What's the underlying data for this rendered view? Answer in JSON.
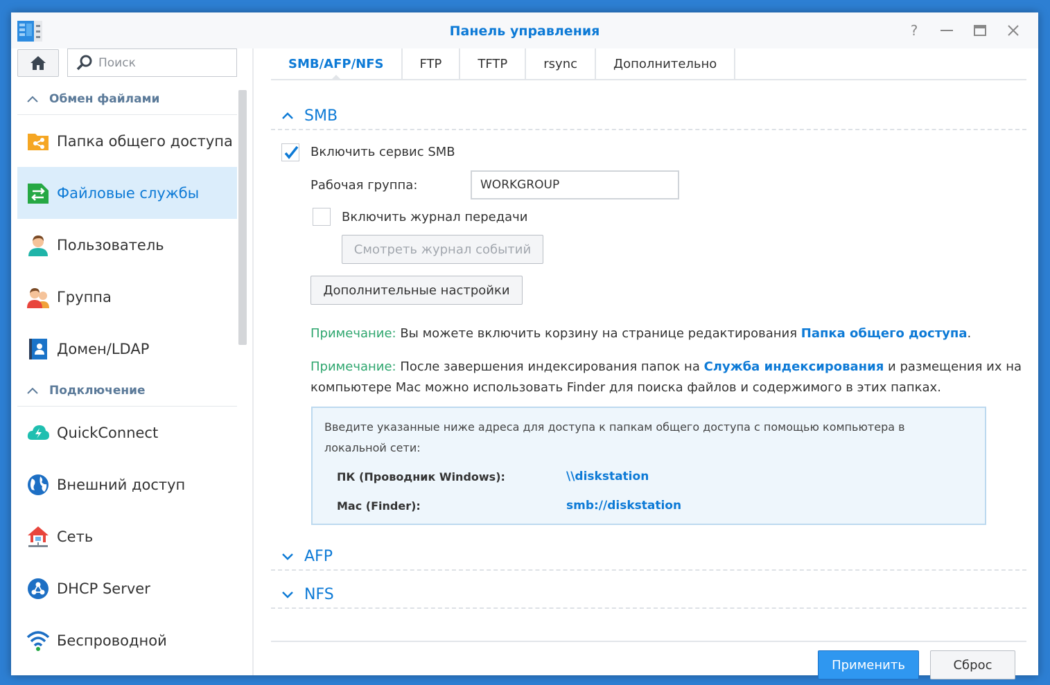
{
  "window": {
    "title": "Панель управления",
    "help": "?",
    "minimize": "—",
    "maximize": "□",
    "close": "✕"
  },
  "sidebar": {
    "search_placeholder": "Поиск",
    "sections": [
      {
        "label": "Обмен файлами",
        "items": [
          {
            "label": "Папка общего доступа",
            "icon": "shared-folder-icon",
            "active": false
          },
          {
            "label": "Файловые службы",
            "icon": "file-services-icon",
            "active": true
          },
          {
            "label": "Пользователь",
            "icon": "user-icon",
            "active": false
          },
          {
            "label": "Группа",
            "icon": "group-icon",
            "active": false
          },
          {
            "label": "Домен/LDAP",
            "icon": "domain-ldap-icon",
            "active": false
          }
        ]
      },
      {
        "label": "Подключение",
        "items": [
          {
            "label": "QuickConnect",
            "icon": "quickconnect-icon",
            "active": false
          },
          {
            "label": "Внешний доступ",
            "icon": "external-access-icon",
            "active": false
          },
          {
            "label": "Сеть",
            "icon": "network-icon",
            "active": false
          },
          {
            "label": "DHCP Server",
            "icon": "dhcp-server-icon",
            "active": false
          },
          {
            "label": "Беспроводной",
            "icon": "wireless-icon",
            "active": false
          }
        ]
      }
    ]
  },
  "tabs": [
    "SMB/AFP/NFS",
    "FTP",
    "TFTP",
    "rsync",
    "Дополнительно"
  ],
  "smb": {
    "title": "SMB",
    "enable_label": "Включить сервис SMB",
    "enable_checked": true,
    "workgroup_label": "Рабочая группа:",
    "workgroup_value": "WORKGROUP",
    "log_label": "Включить журнал передачи",
    "log_checked": false,
    "view_log_button": "Смотреть журнал событий",
    "advanced_button": "Дополнительные настройки",
    "note1": {
      "label": "Примечание:",
      "text": " Вы можете включить корзину на странице редактирования ",
      "link": "Папка общего доступа",
      "end": "."
    },
    "note2": {
      "label": "Примечание:",
      "text": " После завершения индексирования папок на ",
      "link": "Служба индексирования",
      "end": " и размещения их на компьютере Mac можно использовать Finder для поиска файлов и содержимого в этих папках."
    },
    "info": {
      "description": "Введите указанные ниже адреса для доступа к папкам общего доступа с помощью компьютера в локальной сети:",
      "pc_label": "ПК (Проводник Windows):",
      "pc_value": "\\\\diskstation",
      "mac_label": "Mac (Finder):",
      "mac_value": "smb://diskstation"
    }
  },
  "afp": {
    "title": "AFP"
  },
  "nfs": {
    "title": "NFS"
  },
  "footer": {
    "apply": "Применить",
    "reset": "Сброс"
  }
}
